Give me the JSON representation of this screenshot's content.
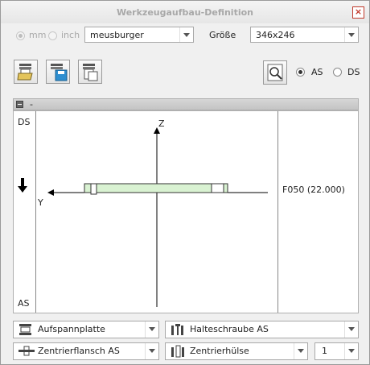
{
  "window": {
    "title": "Werkzeugaufbau-Definition"
  },
  "units": {
    "mm_label": "mm",
    "inch_label": "inch"
  },
  "manufacturer": {
    "value": "meusburger"
  },
  "size": {
    "label": "Größe",
    "value": "346x246"
  },
  "side": {
    "as_label": "AS",
    "ds_label": "DS"
  },
  "panel": {
    "title": "-"
  },
  "view": {
    "top_label": "DS",
    "bottom_label": "AS",
    "axis_z": "Z",
    "axis_y": "Y",
    "plate_info": "F050 (22.000)"
  },
  "bottom": {
    "combo1": "Aufspannplatte",
    "combo2": "Halteschraube AS",
    "combo3": "Zentrierflansch AS",
    "combo4": "Zentrierhülse",
    "combo5": "1"
  }
}
